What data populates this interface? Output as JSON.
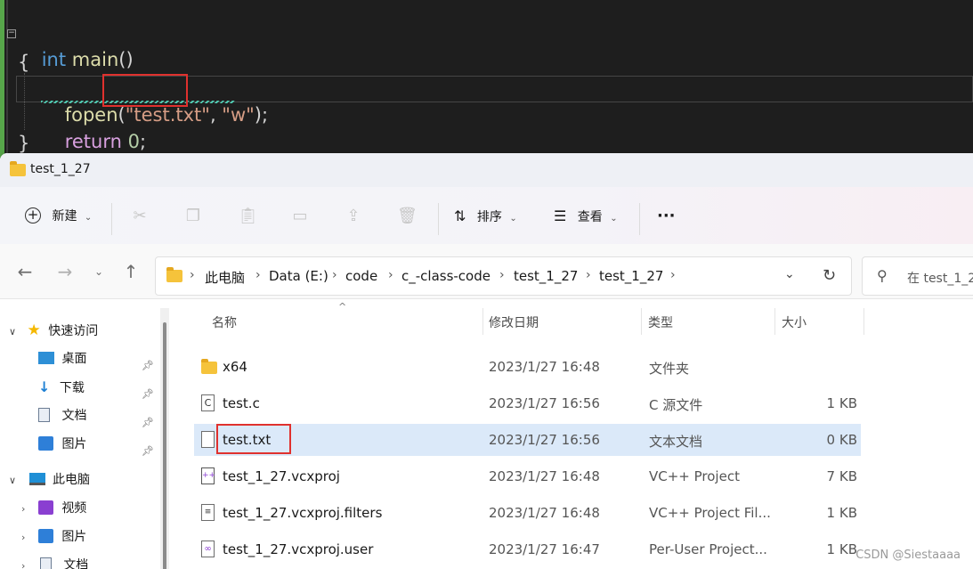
{
  "editor": {
    "line1": {
      "kw": "int",
      "fn": "main",
      "punct": "()"
    },
    "line2": "{",
    "line3": {
      "fn": "fopen",
      "open": "(",
      "arg1": "\"test.txt\"",
      "comma": ", ",
      "arg2": "\"w\"",
      "close": ");"
    },
    "line4": {
      "kw": "return",
      "num": "0",
      "end": ";"
    },
    "line5": "}",
    "collapse_glyph": "−"
  },
  "window": {
    "title": "test_1_27"
  },
  "toolbar": {
    "new_label": "新建",
    "sort_label": "排序",
    "view_label": "查看",
    "more_label": "···",
    "icons": [
      "cut-icon",
      "copy-icon",
      "paste-icon",
      "rename-icon",
      "share-icon",
      "delete-icon"
    ]
  },
  "address": {
    "crumbs": [
      "此电脑",
      "Data (E:)",
      "code",
      "c_-class-code",
      "test_1_27",
      "test_1_27"
    ],
    "search_placeholder": "在 test_1_2"
  },
  "sidebar": {
    "items": [
      {
        "label": "快速访问",
        "icon": "star-icon"
      },
      {
        "label": "桌面",
        "icon": "desktop-icon"
      },
      {
        "label": "下载",
        "icon": "download-icon"
      },
      {
        "label": "文档",
        "icon": "document-icon"
      },
      {
        "label": "图片",
        "icon": "picture-icon"
      },
      {
        "label": "此电脑",
        "icon": "pc-icon"
      },
      {
        "label": "视频",
        "icon": "video-icon"
      },
      {
        "label": "图片",
        "icon": "picture-icon"
      },
      {
        "label": "文档",
        "icon": "document-icon"
      }
    ]
  },
  "columns": [
    "名称",
    "修改日期",
    "类型",
    "大小"
  ],
  "files": [
    {
      "name": "x64",
      "date": "2023/1/27 16:48",
      "type": "文件夹",
      "size": ""
    },
    {
      "name": "test.c",
      "date": "2023/1/27 16:56",
      "type": "C 源文件",
      "size": "1 KB"
    },
    {
      "name": "test.txt",
      "date": "2023/1/27 16:56",
      "type": "文本文档",
      "size": "0 KB"
    },
    {
      "name": "test_1_27.vcxproj",
      "date": "2023/1/27 16:48",
      "type": "VC++ Project",
      "size": "7 KB"
    },
    {
      "name": "test_1_27.vcxproj.filters",
      "date": "2023/1/27 16:48",
      "type": "VC++ Project Fil...",
      "size": "1 KB"
    },
    {
      "name": "test_1_27.vcxproj.user",
      "date": "2023/1/27 16:47",
      "type": "Per-User Project...",
      "size": "1 KB"
    }
  ],
  "watermark": "CSDN @Siestaaaa",
  "colors": {
    "highlight_box": "#e0312e",
    "selection": "#dbe9f9",
    "folder": "#f5c33b"
  }
}
